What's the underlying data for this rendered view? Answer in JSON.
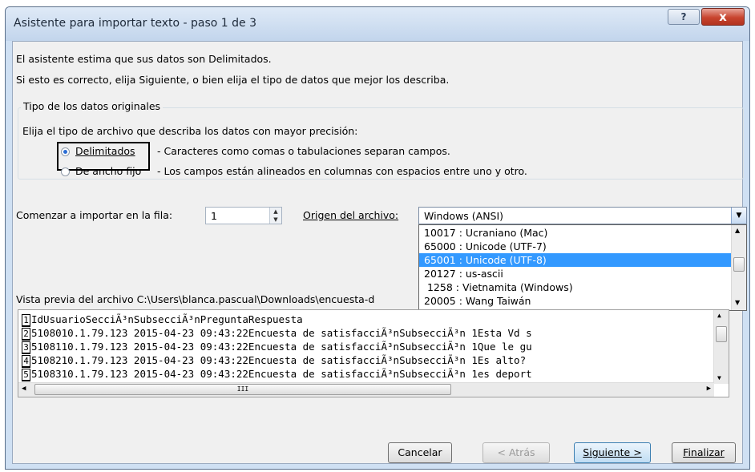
{
  "window": {
    "title": "Asistente para importar texto - paso 1 de 3",
    "help_label": "?",
    "close_label": "x"
  },
  "intro": {
    "line1": "El asistente estima que sus datos son Delimitados.",
    "line2": "Si esto es correcto, elija Siguiente, o bien elija el tipo de datos que mejor los describa."
  },
  "type_group": {
    "label": "Tipo de los datos originales",
    "prompt": "Elija el tipo de archivo que describa los datos con mayor precisión:",
    "options": [
      {
        "label": "Delimitados",
        "description": "- Caracteres como comas o tabulaciones separan campos.",
        "selected": true
      },
      {
        "label": "De ancho fijo",
        "description": "- Los campos están alineados en columnas con espacios entre uno y otro.",
        "selected": false
      }
    ]
  },
  "start_row": {
    "label": "Comenzar a importar en la fila:",
    "value": "1"
  },
  "origin": {
    "label": "Origen del archivo:",
    "value": "Windows (ANSI)",
    "options": [
      "10017 : Ucraniano (Mac)",
      "65000 : Unicode (UTF-7)",
      "65001 : Unicode (UTF-8)",
      "20127 : us-ascii",
      " 1258 : Vietnamita (Windows)",
      "20005 : Wang Taiwán"
    ],
    "highlighted": "65001 : Unicode (UTF-8)"
  },
  "preview": {
    "label": "Vista previa del archivo C:\\Users\\blanca.pascual\\Downloads\\encuesta-d",
    "rows": [
      {
        "num": "1",
        "text": "IdUsuarioSecciÃ³nSubsecciÃ³nPreguntaRespuesta"
      },
      {
        "num": "2",
        "text": "5108010.1.79.123 2015-04-23 09:43:22Encuesta de satisfacciÃ³nSubsecciÃ³n 1Esta Vd s"
      },
      {
        "num": "3",
        "text": "5108110.1.79.123 2015-04-23 09:43:22Encuesta de satisfacciÃ³nSubsecciÃ³n 1Que le gu"
      },
      {
        "num": "4",
        "text": "5108210.1.79.123 2015-04-23 09:43:22Encuesta de satisfacciÃ³nSubsecciÃ³n 1Es alto?"
      },
      {
        "num": "5",
        "text": "5108310.1.79.123 2015-04-23 09:43:22Encuesta de satisfacciÃ³nSubsecciÃ³n 1es deport"
      }
    ],
    "hscroll_grip": "III"
  },
  "buttons": {
    "cancel": "Cancelar",
    "back": "< Atrás",
    "next": "Siguiente >",
    "finish": "Finalizar"
  },
  "icons": [
    "help-icon",
    "close-icon",
    "spin-icon",
    "dropdown-arrow-icon",
    "scroll-arrow-icons"
  ],
  "colors": {
    "selection": "#3399ff",
    "title_bar": "#c2d5ec",
    "close_button": "#c8442e"
  }
}
